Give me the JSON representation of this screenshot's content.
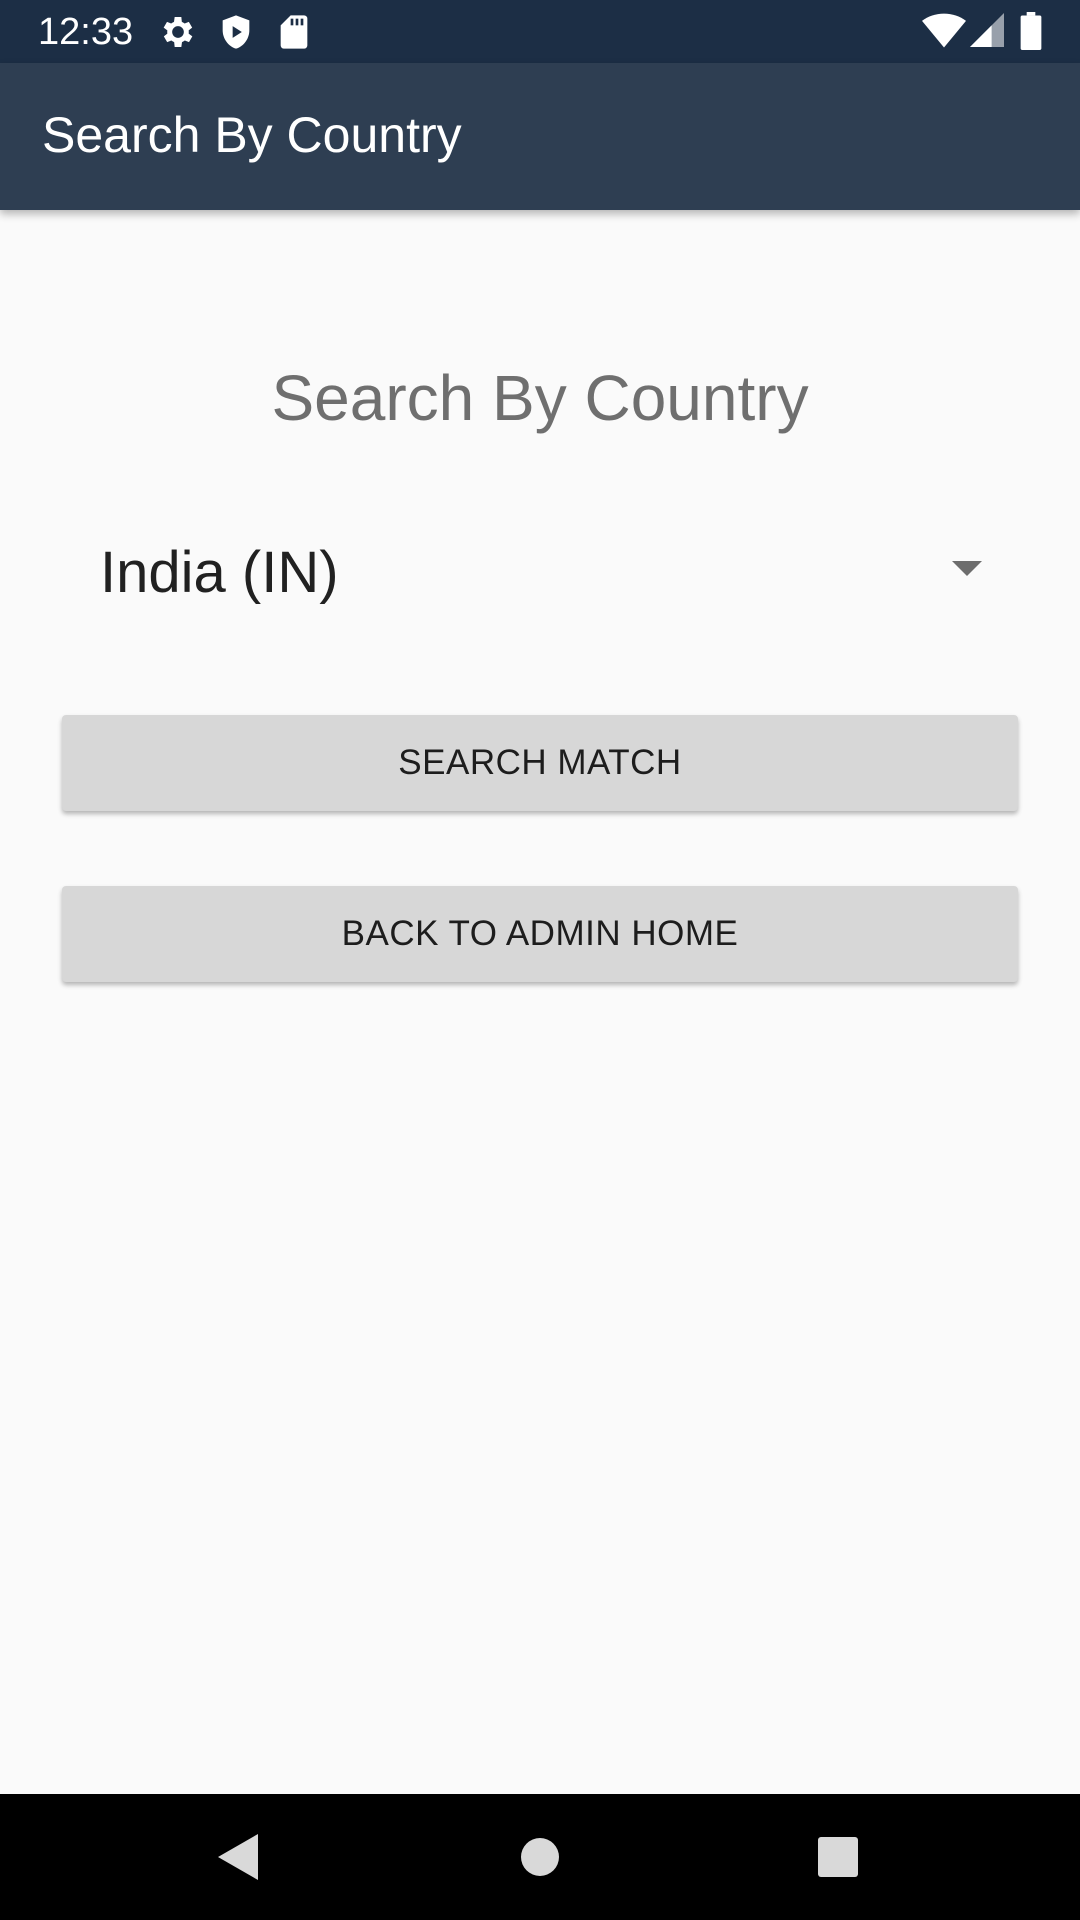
{
  "status_bar": {
    "time": "12:33",
    "icons_left": [
      "settings-icon",
      "shield-icon",
      "sd-card-icon"
    ],
    "icons_right": [
      "wifi-icon",
      "cell-signal-icon",
      "battery-icon"
    ],
    "background": "#1c2e45"
  },
  "app_bar": {
    "title": "Search By Country",
    "background": "#2e3e52"
  },
  "main": {
    "heading": "Search By Country",
    "country_select": {
      "selected": "India (IN)"
    },
    "search_button_label": "SEARCH MATCH",
    "back_button_label": "BACK TO ADMIN HOME"
  },
  "nav_bar": {
    "buttons": [
      "back-icon",
      "home-icon",
      "recents-icon"
    ]
  }
}
